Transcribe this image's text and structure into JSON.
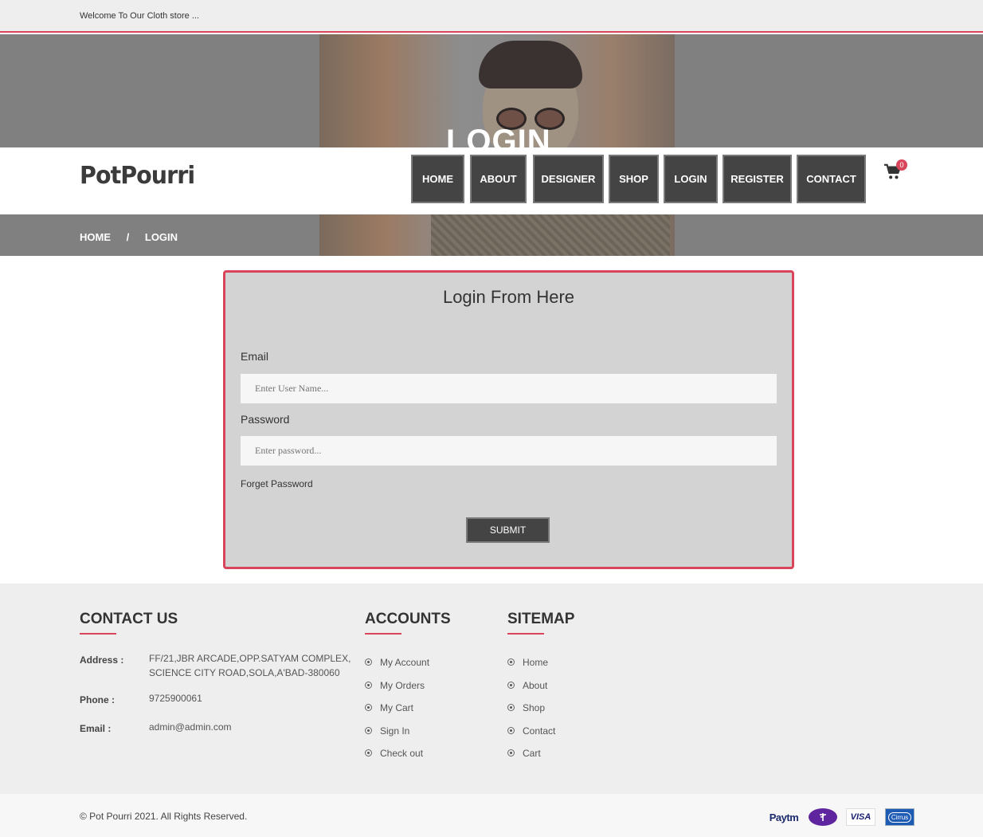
{
  "topbar": {
    "welcome": "Welcome To Our Cloth store ..."
  },
  "hero": {
    "title": "LOGIN"
  },
  "header": {
    "logo": "PotPourri",
    "nav": [
      "HOME",
      "ABOUT",
      "DESIGNER",
      "SHOP",
      "LOGIN",
      "REGISTER",
      "CONTACT"
    ],
    "cart_count": "0"
  },
  "breadcrumb": {
    "home": "HOME",
    "separator": "/",
    "current": "LOGIN"
  },
  "login": {
    "title": "Login From Here",
    "email_label": "Email",
    "email_placeholder": "Enter User Name...",
    "password_label": "Password",
    "password_placeholder": "Enter password...",
    "forget": "Forget Password",
    "submit": "SUBMIT"
  },
  "footer": {
    "contact_title": "CONTACT US",
    "address_label": "Address :",
    "address_line1": "FF/21,JBR ARCADE,OPP.SATYAM COMPLEX,",
    "address_line2": "SCIENCE CITY ROAD,SOLA,A'BAD-380060",
    "phone_label": "Phone :",
    "phone": "9725900061",
    "email_label": "Email :",
    "email": "admin@admin.com",
    "accounts_title": "ACCOUNTS",
    "accounts": [
      "My Account",
      "My Orders",
      "My Cart",
      "Sign In",
      "Check out"
    ],
    "sitemap_title": "SITEMAP",
    "sitemap": [
      "Home",
      "About",
      "Shop",
      "Contact",
      "Cart"
    ]
  },
  "bottom": {
    "copyright": "© Pot Pourri 2021. All Rights Reserved.",
    "payments": [
      "Paytm",
      "PhonePe",
      "VISA",
      "Cirrus"
    ]
  },
  "colors": {
    "accent": "#d9455a",
    "nav_bg": "#444444",
    "footer_bg": "#eeeeee"
  }
}
